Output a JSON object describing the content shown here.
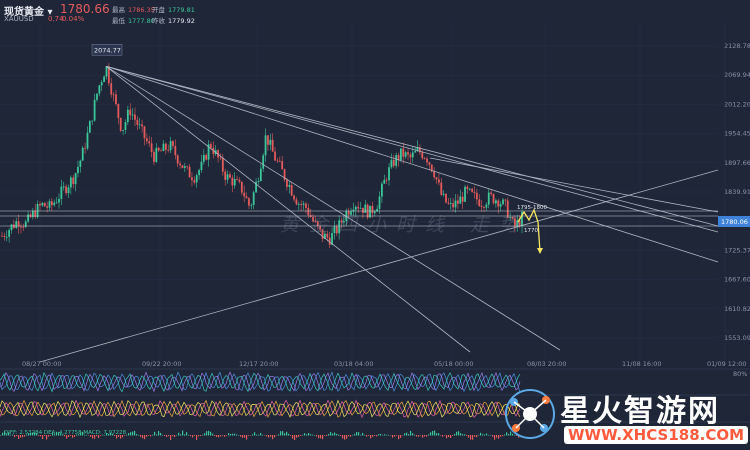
{
  "header": {
    "title": "现货黄金",
    "symbol": "XAUUSD",
    "price": "1780.66",
    "change": "0.74",
    "change_pct": "0.04%",
    "stats": [
      {
        "label": "最高",
        "value": "1786.35",
        "color": "#e45b5b"
      },
      {
        "label": "开盘",
        "value": "1779.81",
        "color": "#3cc79a"
      },
      {
        "label": "最低",
        "value": "1777.80",
        "color": "#3cc79a"
      },
      {
        "label": "昨收",
        "value": "1779.92",
        "color": "#e6e9ef"
      }
    ]
  },
  "annotations": {
    "peak_label": "2074.77",
    "range_label": "1795-1800",
    "low_label": "1770",
    "current_price_tag": "1780.06"
  },
  "indicators": {
    "macd_label": "DIFF: 2.53284  DEA: 4.27758  MACD: 7.97228",
    "percent_label": "80%"
  },
  "watermark": "黄金四小时线 走势",
  "logo": {
    "text": "星火智游网",
    "url": "WWW.XHCS188.COM"
  },
  "colors": {
    "background": "#1e2638",
    "up": "#3cc79a",
    "down": "#e45b5b",
    "trendline": "#aeb5c2",
    "arrow": "#f5e663"
  },
  "chart_data": {
    "type": "candlestick",
    "y_ticks": [
      "2128.78",
      "2069.94",
      "2012.20",
      "1954.45",
      "1897.66",
      "1839.91",
      "1780.06",
      "1725.37",
      "1667.60",
      "1610.82",
      "1553.09"
    ],
    "x_ticks": [
      "08/27 00:00",
      "09/22 20:00",
      "12/17 20:00",
      "03/18 04:00",
      "05/18 00:00",
      "08/03 20:00",
      "11/08 16:00",
      "01/09 12:00"
    ],
    "ylim": [
      1500,
      2160
    ],
    "close_path": [
      1745,
      1760,
      1775,
      1768,
      1790,
      1805,
      1800,
      1820,
      1840,
      1860,
      1900,
      1960,
      2030,
      2074,
      2010,
      1950,
      1990,
      1960,
      1930,
      1900,
      1910,
      1920,
      1895,
      1870,
      1860,
      1880,
      1925,
      1895,
      1860,
      1850,
      1835,
      1800,
      1860,
      1940,
      1900,
      1870,
      1840,
      1810,
      1800,
      1770,
      1745,
      1740,
      1760,
      1790,
      1810,
      1800,
      1790,
      1810,
      1860,
      1890,
      1905,
      1895,
      1910,
      1900,
      1870,
      1820,
      1800,
      1810,
      1830,
      1820,
      1810,
      1820,
      1815,
      1800,
      1760,
      1780
    ]
  }
}
